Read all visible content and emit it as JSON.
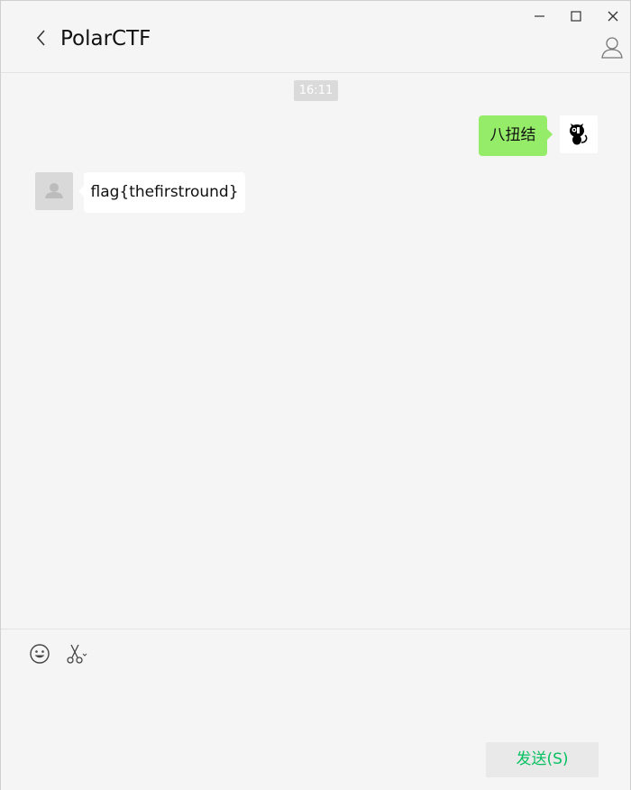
{
  "chat": {
    "title": "PolarCTF"
  },
  "messages": {
    "timestamp": "16:11",
    "outgoing": {
      "text": "八扭结",
      "bubble_color": "#95ec69"
    },
    "incoming": {
      "text": "flag{thefirstround}",
      "bubble_color": "#ffffff"
    }
  },
  "toolbar": {
    "icons": [
      "emoji-icon",
      "scissors-icon"
    ]
  },
  "input": {
    "value": "",
    "send_label": "发送(S)",
    "send_color": "#07c160"
  }
}
